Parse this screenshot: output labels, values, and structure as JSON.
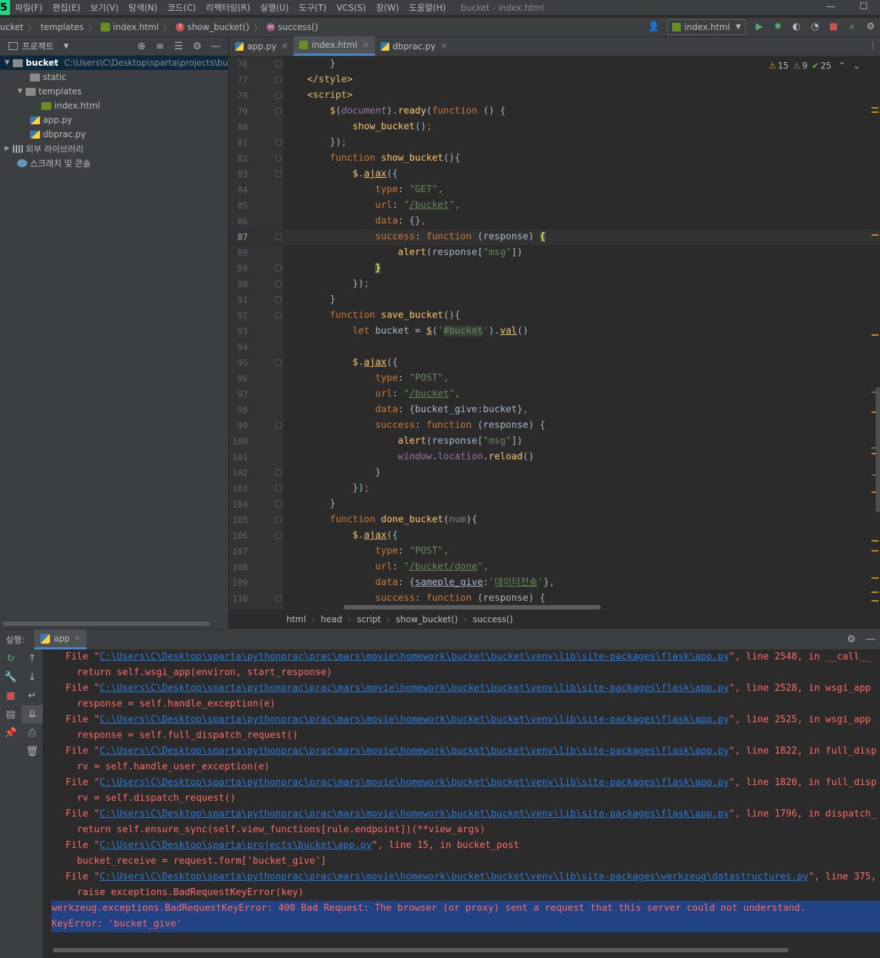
{
  "menubar": {
    "logo": "PC",
    "items": [
      "파일(F)",
      "편집(E)",
      "보기(V)",
      "탐색(N)",
      "코드(C)",
      "리팩터링(R)",
      "실행(U)",
      "도구(T)",
      "VCS(S)",
      "창(W)",
      "도움말(H)"
    ],
    "window_title": "bucket - index.html"
  },
  "navbar": {
    "crumbs": [
      "ucket",
      "templates",
      "index.html",
      "show_bucket()",
      "success()"
    ],
    "run_config": "index.html"
  },
  "project": {
    "title": "프로젝트",
    "root_name": "bucket",
    "root_path": "C:\\Users\\C\\Desktop\\sparta\\projects\\bu",
    "items": [
      "static",
      "templates",
      "index.html",
      "app.py",
      "dbprac.py",
      "외부 라이브러리",
      "스크래치 및 콘솔"
    ]
  },
  "tabs": [
    {
      "label": "app.py"
    },
    {
      "label": "index.html"
    },
    {
      "label": "dbprac.py"
    }
  ],
  "inspections": {
    "warnings": "15",
    "weak_warnings": "9",
    "typos": "25"
  },
  "code_line_numbers": [
    "76",
    "77",
    "78",
    "79",
    "80",
    "81",
    "82",
    "83",
    "84",
    "85",
    "86",
    "87",
    "88",
    "89",
    "90",
    "91",
    "92",
    "93",
    "94",
    "95",
    "96",
    "97",
    "98",
    "99",
    "100",
    "101",
    "102",
    "103",
    "104",
    "105",
    "106",
    "107",
    "108",
    "109",
    "110"
  ],
  "breadcrumb_bottom": [
    "html",
    "head",
    "script",
    "show_bucket()",
    "success()"
  ],
  "run": {
    "label": "실행:",
    "tab": "app",
    "console": [
      {
        "pre": "    File \"",
        "link": "C:\\Users\\C\\Desktop\\sparta\\pythonprac\\prac\\mars\\movie\\homework\\bucket\\bucket\\venv\\lib\\site-packages\\flask\\app.py",
        "post": "\", line 2548, in __call__"
      },
      {
        "text": "      return self.wsgi_app(environ, start_response)"
      },
      {
        "pre": "    File \"",
        "link": "C:\\Users\\C\\Desktop\\sparta\\pythonprac\\prac\\mars\\movie\\homework\\bucket\\bucket\\venv\\lib\\site-packages\\flask\\app.py",
        "post": "\", line 2528, in wsgi_app"
      },
      {
        "text": "      response = self.handle_exception(e)"
      },
      {
        "pre": "    File \"",
        "link": "C:\\Users\\C\\Desktop\\sparta\\pythonprac\\prac\\mars\\movie\\homework\\bucket\\bucket\\venv\\lib\\site-packages\\flask\\app.py",
        "post": "\", line 2525, in wsgi_app"
      },
      {
        "text": "      response = self.full_dispatch_request()"
      },
      {
        "pre": "    File \"",
        "link": "C:\\Users\\C\\Desktop\\sparta\\pythonprac\\prac\\mars\\movie\\homework\\bucket\\bucket\\venv\\lib\\site-packages\\flask\\app.py",
        "post": "\", line 1822, in full_disp"
      },
      {
        "text": "      rv = self.handle_user_exception(e)"
      },
      {
        "pre": "    File \"",
        "link": "C:\\Users\\C\\Desktop\\sparta\\pythonprac\\prac\\mars\\movie\\homework\\bucket\\bucket\\venv\\lib\\site-packages\\flask\\app.py",
        "post": "\", line 1820, in full_disp"
      },
      {
        "text": "      rv = self.dispatch_request()"
      },
      {
        "pre": "    File \"",
        "link": "C:\\Users\\C\\Desktop\\sparta\\pythonprac\\prac\\mars\\movie\\homework\\bucket\\bucket\\venv\\lib\\site-packages\\flask\\app.py",
        "post": "\", line 1796, in dispatch_"
      },
      {
        "text": "      return self.ensure_sync(self.view_functions[rule.endpoint])(**view_args)"
      },
      {
        "pre": "    File \"",
        "link": "C:\\Users\\C\\Desktop\\sparta\\projects\\bucket\\app.py",
        "post": "\", line 15, in bucket_post"
      },
      {
        "text": "      bucket_receive = request.form['bucket_give']"
      },
      {
        "pre": "    File \"",
        "link": "C:\\Users\\C\\Desktop\\sparta\\pythonprac\\prac\\mars\\movie\\homework\\bucket\\bucket\\venv\\lib\\site-packages\\werkzeug\\datastructures.py",
        "post": "\", line 375,"
      },
      {
        "text": "      raise exceptions.BadRequestKeyError(key)"
      },
      {
        "text": "werkzeug.exceptions.BadRequestKeyError: 400 Bad Request: The browser (or proxy) sent a request that this server could not understand.",
        "highlight": true
      },
      {
        "text": "KeyError: 'bucket_give'",
        "highlight": true
      }
    ]
  }
}
